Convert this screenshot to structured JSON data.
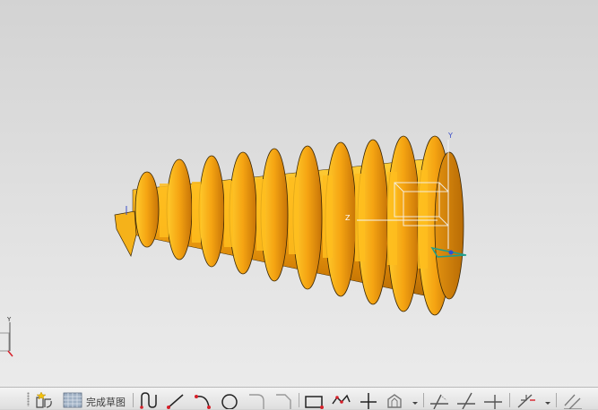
{
  "viewport": {
    "model": "worm-screw",
    "model_color": "#f2a30f",
    "csys_axes": [
      "Y",
      "Z"
    ],
    "mini_triad_axis": "Y"
  },
  "toolbar": {
    "finish_sketch_label": "完成草图",
    "tools": [
      "sketch-icon",
      "finish-sketch-icon",
      "profile-icon",
      "line-icon",
      "arc-icon",
      "circle-icon",
      "fillet-icon",
      "chamfer-icon",
      "rectangle-icon",
      "polygon-icon",
      "point-icon",
      "offset-curve-icon",
      "dropdown-icon",
      "quick-trim-icon",
      "quick-extend-icon",
      "make-corner-icon",
      "constraint-icon",
      "dropdown-icon",
      "parallel-icon"
    ]
  }
}
